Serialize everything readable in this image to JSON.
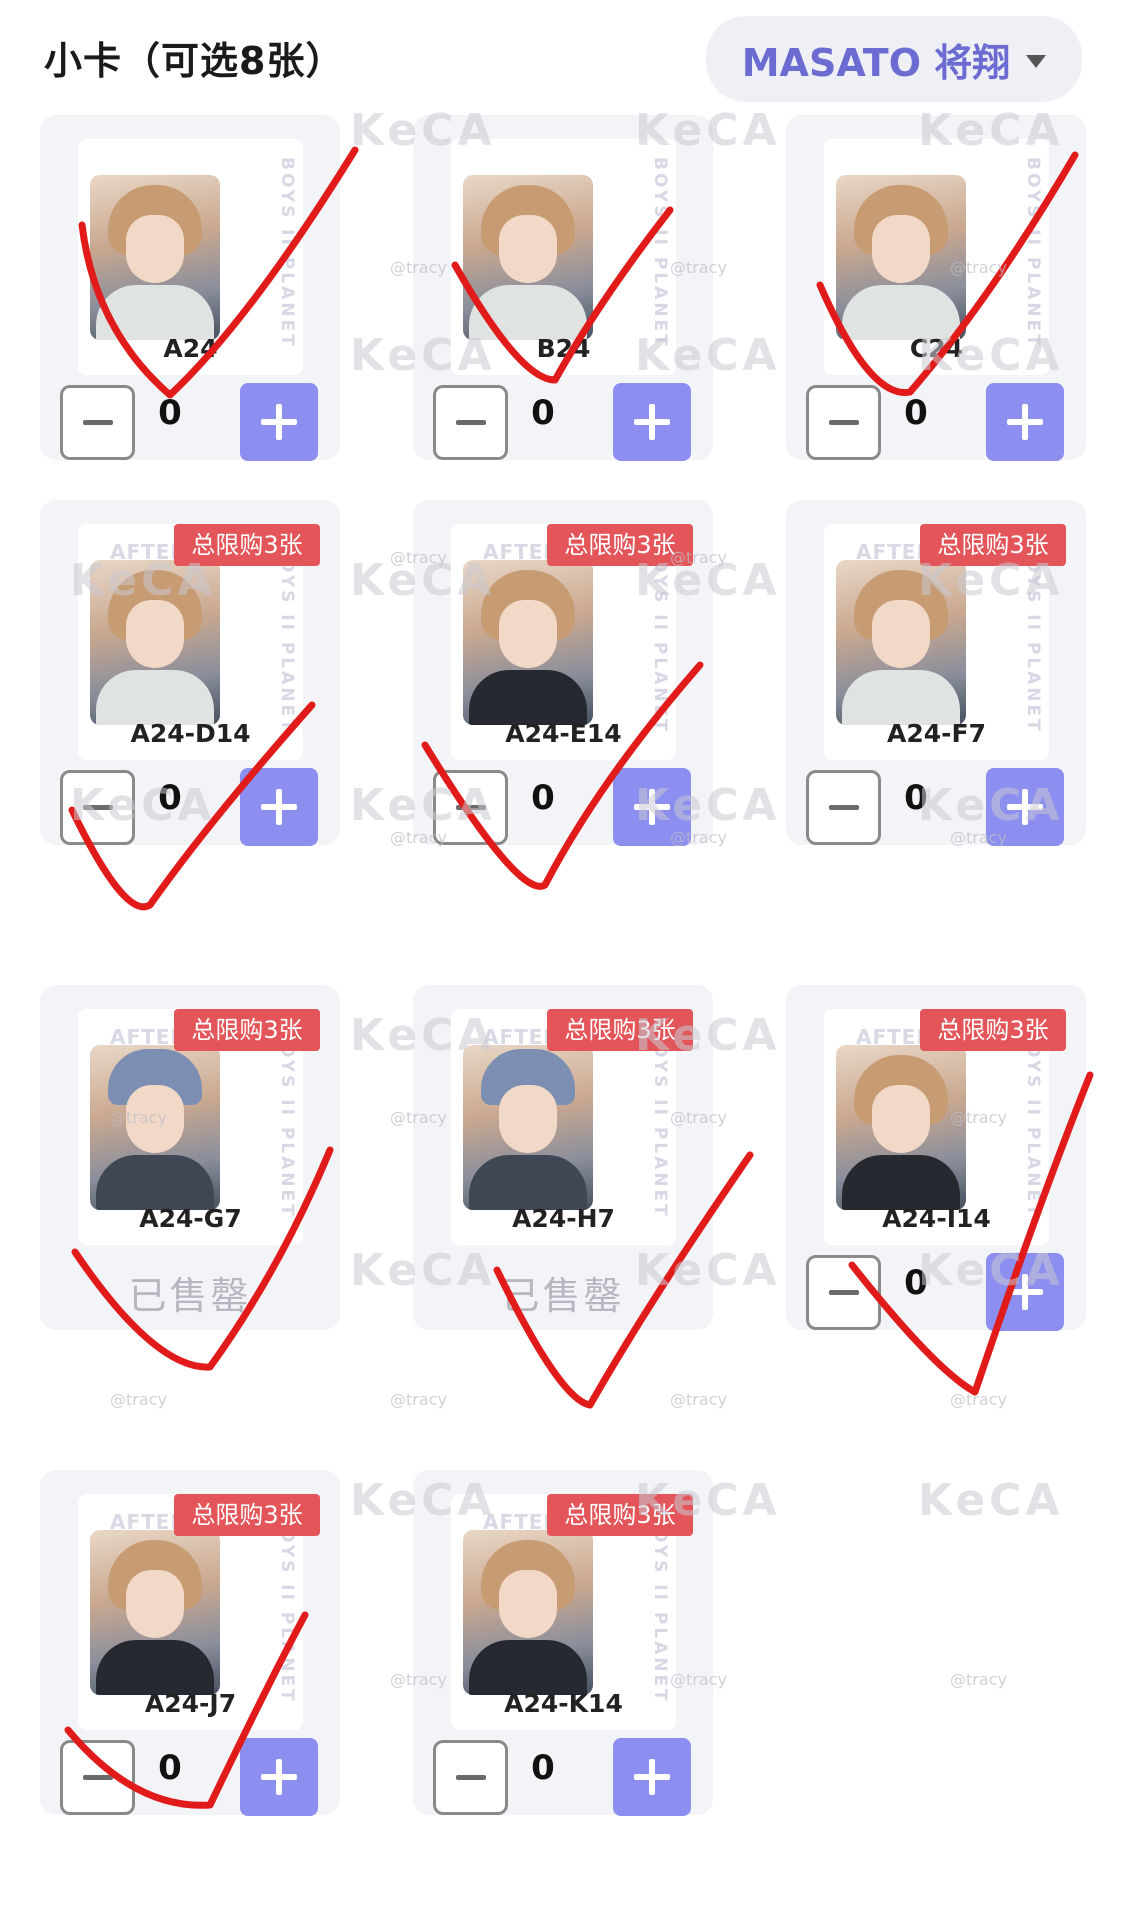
{
  "header": {
    "title": "小卡（可选8张）",
    "member_select": {
      "label": "MASATO 将翔"
    }
  },
  "cards": [
    {
      "code": "A24",
      "limit_badge": "",
      "quantity": "0",
      "sold_out": "",
      "inner_label": "",
      "side_text": "BOYS II PLANET",
      "photo_style": "light",
      "checked": true
    },
    {
      "code": "B24",
      "limit_badge": "",
      "quantity": "0",
      "sold_out": "",
      "inner_label": "",
      "side_text": "BOYS II PLANET",
      "photo_style": "light",
      "checked": true
    },
    {
      "code": "C24",
      "limit_badge": "",
      "quantity": "0",
      "sold_out": "",
      "inner_label": "",
      "side_text": "BOYS II PLANET",
      "photo_style": "light",
      "checked": true
    },
    {
      "code": "A24-D14",
      "limit_badge": "总限购3张",
      "quantity": "0",
      "sold_out": "",
      "inner_label": "AFTER",
      "side_text": "BOYS II PLANET",
      "photo_style": "light",
      "checked": true
    },
    {
      "code": "A24-E14",
      "limit_badge": "总限购3张",
      "quantity": "0",
      "sold_out": "",
      "inner_label": "AFTER",
      "side_text": "BOYS II PLANET",
      "photo_style": "dark",
      "checked": true
    },
    {
      "code": "A24-F7",
      "limit_badge": "总限购3张",
      "quantity": "0",
      "sold_out": "",
      "inner_label": "AFTER",
      "side_text": "BOYS II PLANET",
      "photo_style": "light",
      "checked": false
    },
    {
      "code": "A24-G7",
      "limit_badge": "总限购3张",
      "quantity": "",
      "sold_out": "已售罄",
      "inner_label": "AFTER",
      "side_text": "BOYS II PLANET",
      "photo_style": "hat",
      "checked": true
    },
    {
      "code": "A24-H7",
      "limit_badge": "总限购3张",
      "quantity": "",
      "sold_out": "已售罄",
      "inner_label": "AFTER",
      "side_text": "BOYS II PLANET",
      "photo_style": "hat",
      "checked": true
    },
    {
      "code": "A24-I14",
      "limit_badge": "总限购3张",
      "quantity": "0",
      "sold_out": "",
      "inner_label": "AFTER",
      "side_text": "BOYS II PLANET",
      "photo_style": "dark",
      "checked": true
    },
    {
      "code": "A24-J7",
      "limit_badge": "总限购3张",
      "quantity": "0",
      "sold_out": "",
      "inner_label": "AFTER",
      "side_text": "BOYS II PLANET",
      "photo_style": "dark",
      "checked": true
    },
    {
      "code": "A24-K14",
      "limit_badge": "总限购3张",
      "quantity": "0",
      "sold_out": "",
      "inner_label": "AFTER",
      "side_text": "BOYS II PLANET",
      "photo_style": "dark",
      "checked": false
    }
  ],
  "watermarks": {
    "logo": "KeCA",
    "handle": "@tracy"
  },
  "colors": {
    "accent": "#8c8ef0",
    "badge": "#e35559",
    "check_mark": "#e11a1a",
    "member_text": "#6b6bd2"
  }
}
